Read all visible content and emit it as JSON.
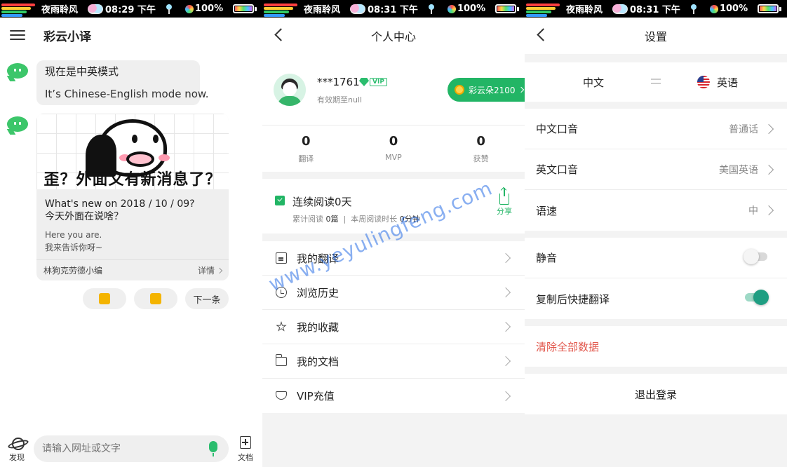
{
  "status_bar": {
    "brand": "夜雨聆风",
    "panels": [
      {
        "time": "08:29 下午",
        "battery": "100%"
      },
      {
        "time": "08:31 下午",
        "battery": "100%"
      },
      {
        "time": "08:31 下午",
        "battery": "100%"
      }
    ]
  },
  "chat": {
    "app_title": "彩云小译",
    "msg1": {
      "line1": "现在是中英模式",
      "line2": "It’s Chinese-English mode now."
    },
    "card": {
      "meme_caption": "歪？外面又有新消息了？",
      "question_en": "What's new on 2018 / 10 / 09?",
      "question_cn": "今天外面在说啥？",
      "answer_en": "Here you are.",
      "answer_cn": "我来告诉你呀~",
      "author": "林狗克劳德小编",
      "detail": "详情"
    },
    "actions": {
      "next": "下一条"
    },
    "bottom": {
      "discover": "发现",
      "search_placeholder": "请输入网址或文字",
      "docs": "文档"
    }
  },
  "profile": {
    "title": "个人中心",
    "username": "***1761",
    "vip": "VIP",
    "validity": "有效期至null",
    "coins": "彩云朵2100",
    "stats": [
      {
        "value": "0",
        "label": "翻译"
      },
      {
        "value": "0",
        "label": "MVP"
      },
      {
        "value": "0",
        "label": "获赞"
      }
    ],
    "reading": {
      "title": "连续阅读0天",
      "total_label": "累计阅读",
      "total_value": "0篇",
      "week_label": "本周阅读时长",
      "week_value": "0分钟",
      "share": "分享"
    },
    "menu": [
      "我的翻译",
      "浏览历史",
      "我的收藏",
      "我的文档",
      "VIP充值"
    ]
  },
  "settings": {
    "title": "设置",
    "source_lang": "中文",
    "target_lang": "英语",
    "rows": [
      {
        "label": "中文口音",
        "value": "普通话"
      },
      {
        "label": "英文口音",
        "value": "美国英语"
      },
      {
        "label": "语速",
        "value": "中"
      }
    ],
    "toggles": [
      {
        "label": "静音",
        "on": false
      },
      {
        "label": "复制后快捷翻译",
        "on": true
      }
    ],
    "clear_data": "清除全部数据",
    "logout": "退出登录"
  },
  "watermark": "www.yeyulingfeng.com",
  "colors": {
    "accent": "#22b565",
    "danger": "#e2574c",
    "toggle_on": "#1f9e82"
  }
}
